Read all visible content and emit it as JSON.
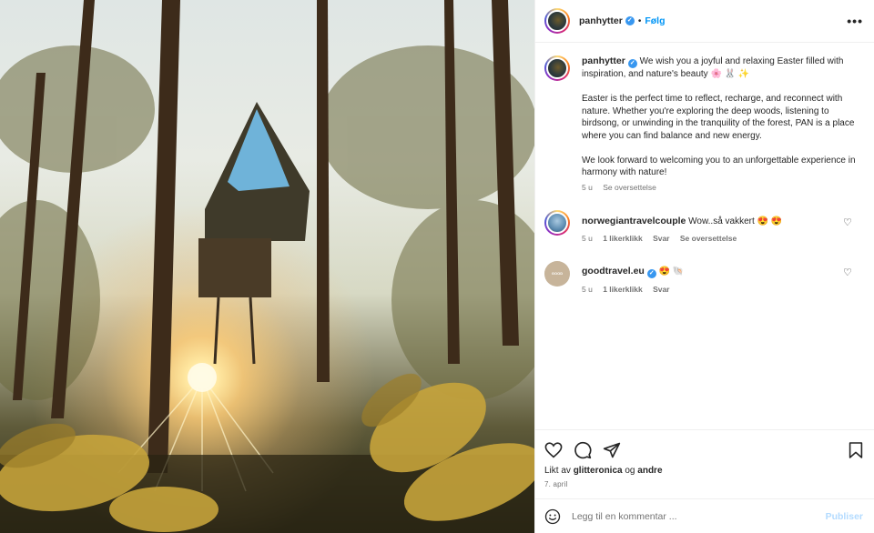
{
  "post": {
    "image_alt": "Forest cabin with sunset through trees",
    "author": "panhytter",
    "follow_label": "Følg",
    "dot": "•",
    "more_label": "•••"
  },
  "caption": {
    "author": "panhytter",
    "line1": "We wish you a joyful and relaxing Easter filled with inspiration, and nature's beauty 🌸 🐰 ✨",
    "paragraph2": "Easter is the perfect time to reflect, recharge, and reconnect with nature. Whether you're exploring the deep woods, listening to birdsong, or unwinding in the tranquility of the forest, PAN is a place where you can find balance and new energy.",
    "paragraph3": "We look forward to welcoming you to an unforgettable experience in harmony with nature!",
    "time": "5 u",
    "translate": "Se oversettelse"
  },
  "comments": [
    {
      "author": "norwegiantravelcouple",
      "text": "Wow..så vakkert 😍 😍",
      "time": "5 u",
      "likes": "1 likerklikk",
      "reply": "Svar",
      "translate": "Se oversettelse"
    },
    {
      "author": "goodtravel.eu",
      "text": "😍 🐚",
      "time": "5 u",
      "likes": "1 likerklikk",
      "reply": "Svar",
      "avatar_text": "GOOD TRAVEL"
    }
  ],
  "liked": {
    "prefix": "Likt av",
    "user": "glitteronica",
    "conj": "og",
    "others": "andre"
  },
  "date": "7. april",
  "add_comment": {
    "placeholder": "Legg til en kommentar ...",
    "publish": "Publiser"
  },
  "icons": {
    "verified": "✓",
    "heart": "♡"
  },
  "colors": {
    "accent": "#0095f6",
    "verified": "#3897f0",
    "publish_disabled": "#b3dbff"
  }
}
